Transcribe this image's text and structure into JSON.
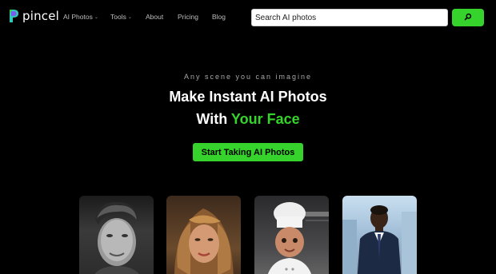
{
  "header": {
    "brand": "pincel",
    "nav": [
      {
        "label": "AI Photos",
        "dropdown": true
      },
      {
        "label": "Tools",
        "dropdown": true
      },
      {
        "label": "About",
        "dropdown": false
      },
      {
        "label": "Pricing",
        "dropdown": false
      },
      {
        "label": "Blog",
        "dropdown": false
      }
    ],
    "search": {
      "placeholder": "Search AI photos",
      "value": "",
      "button_icon": "search-icon"
    }
  },
  "hero": {
    "tagline": "Any scene you can imagine",
    "title_line1": "Make Instant AI Photos",
    "title_line2_prefix": "With",
    "title_line2_accent": "Your Face",
    "cta_label": "Start Taking AI Photos"
  },
  "gallery": [
    {
      "icon": "portrait-man-photo"
    },
    {
      "icon": "portrait-woman-photo"
    },
    {
      "icon": "portrait-child-chef-photo"
    },
    {
      "icon": "portrait-businessman-photo"
    }
  ],
  "colors": {
    "accent": "#35d32c",
    "background": "#000000",
    "nav_text": "#bdbdbd"
  }
}
